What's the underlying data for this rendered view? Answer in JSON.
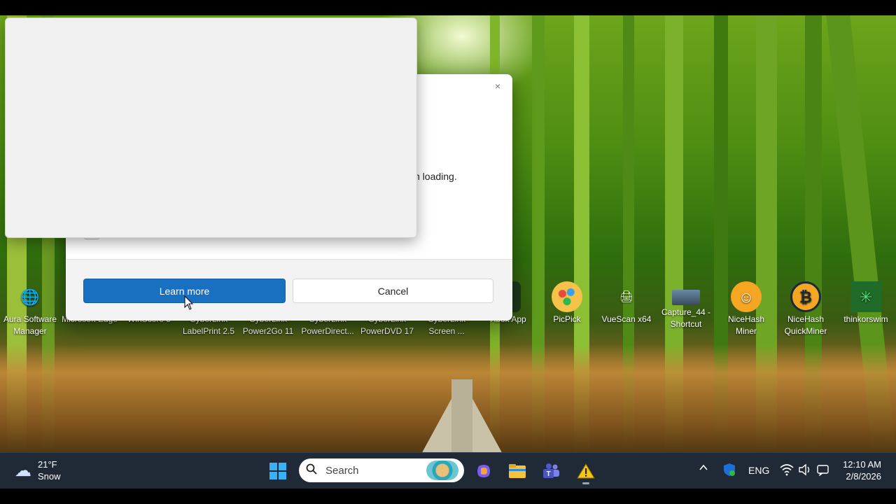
{
  "desktop_icons": [
    {
      "label": "Aura Software Manager",
      "icon": "globe-icon",
      "color": "#2a7fd4"
    },
    {
      "label": "Microsoft Edge",
      "icon": "edge-icon",
      "color": "#1e88e5"
    },
    {
      "label": "WinScore 5",
      "icon": "app-icon",
      "color": "#888888"
    },
    {
      "label": "CyberLink LabelPrint 2.5",
      "icon": "app-icon",
      "color": "#888888"
    },
    {
      "label": "CyberLink Power2Go 11",
      "icon": "app-icon",
      "color": "#888888"
    },
    {
      "label": "CyberLink PowerDirect...",
      "icon": "app-icon",
      "color": "#888888"
    },
    {
      "label": "CyberLink PowerDVD 17",
      "icon": "app-icon",
      "color": "#888888"
    },
    {
      "label": "CyberLink Screen ...",
      "icon": "app-icon",
      "color": "#888888"
    },
    {
      "label": "Xbox App",
      "icon": "xbox-icon",
      "color": "#1d5e1d"
    },
    {
      "label": "PicPick",
      "icon": "palette-icon",
      "color": "#f2b63a"
    },
    {
      "label": "VueScan x64",
      "icon": "scanner-icon",
      "color": "#c8d8e8"
    },
    {
      "label": "Capture_44 - Shortcut",
      "icon": "video-icon",
      "color": "#4a5a6a"
    },
    {
      "label": "NiceHash Miner",
      "icon": "nicehash-icon",
      "color": "#f7a623"
    },
    {
      "label": "NiceHash QuickMiner",
      "icon": "nicehash-quickminer-icon",
      "color": "#f7a623"
    },
    {
      "label": "thinkorswim",
      "icon": "thinkorswim-icon",
      "color": "#2db84b"
    }
  ],
  "dialog": {
    "message_visible": "t from loading.",
    "learn_more": "Learn more",
    "cancel": "Cancel",
    "close_symbol": "×"
  },
  "taskbar": {
    "weather_temp": "21°F",
    "weather_desc": "Snow",
    "search_placeholder": "Search",
    "language": "ENG",
    "time": "12:10 AM",
    "date": "2/8/2026"
  },
  "colors": {
    "accent": "#1a70c0",
    "taskbar": "#1f2a36"
  }
}
